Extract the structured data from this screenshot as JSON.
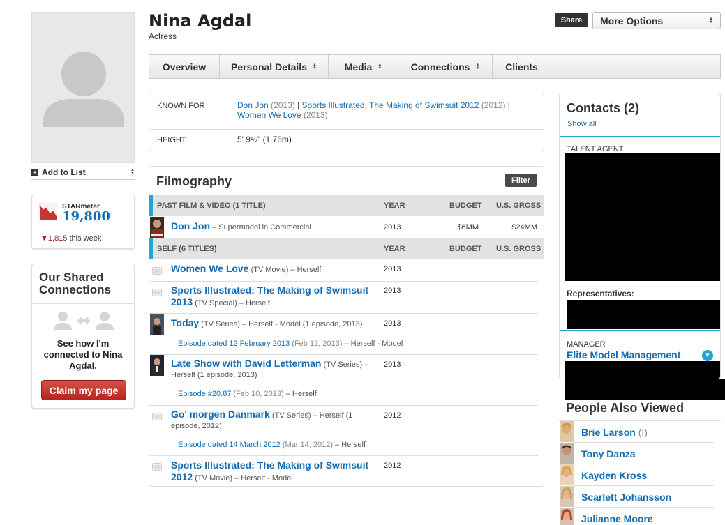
{
  "profile": {
    "name": "Nina Agdal",
    "job": "Actress",
    "add_to_list": "Add to List"
  },
  "starmeter": {
    "label": "STARmeter",
    "rank": "19,800",
    "change": "1,815",
    "change_suffix": " this week"
  },
  "shared": {
    "title": "Our Shared Connections",
    "message": "See how I'm connected to Nina Agdal.",
    "claim": "Claim my page"
  },
  "header": {
    "share": "Share",
    "more_options": "More Options"
  },
  "nav": {
    "tabs": [
      {
        "label": "Overview",
        "caret": false
      },
      {
        "label": "Personal Details",
        "caret": true
      },
      {
        "label": "Media",
        "caret": true
      },
      {
        "label": "Connections",
        "caret": true
      },
      {
        "label": "Clients",
        "caret": false
      }
    ]
  },
  "known_for": {
    "label": "KNOWN FOR",
    "titles": [
      {
        "title": "Don Jon",
        "year": "(2013)"
      },
      {
        "title": "Sports Illustrated: The Making of Swimsuit 2012",
        "year": "(2012)"
      },
      {
        "title": "Women We Love",
        "year": "(2013)"
      }
    ],
    "height_label": "HEIGHT",
    "height_value": "5' 9½\" (1.76m)"
  },
  "filmography": {
    "title": "Filmography",
    "filter": "Filter",
    "columns": {
      "year": "YEAR",
      "budget": "BUDGET",
      "gross": "U.S. GROSS"
    },
    "section1": "PAST FILM & VIDEO (1 TITLE)",
    "section2": "SELF (6 TITLES)",
    "film": {
      "title": "Don Jon",
      "role": " – Supermodel in Commercial",
      "year": "2013",
      "budget": "$6MM",
      "gross": "$24MM"
    },
    "self": [
      {
        "title": "Women We Love",
        "detail": " (TV Movie) – Herself",
        "year": "2013"
      },
      {
        "title": "Sports Illustrated: The Making of Swimsuit 2013",
        "detail": " (TV Special) – Herself",
        "year": "2013"
      },
      {
        "title": "Today",
        "detail": " (TV Series) – Herself - Model (1 episode, 2013)",
        "year": "2013",
        "episode": {
          "name": "Episode dated 12 February 2013",
          "date": " (Feb 12, 2013)",
          "role": " – Herself - Model"
        }
      },
      {
        "title": "Late Show with David Letterman",
        "detail": " (TV Series) – Herself (1 episode, 2013)",
        "year": "2013",
        "episode": {
          "name": "Episode #20.87",
          "date": " (Feb 10, 2013)",
          "role": " – Herself"
        }
      },
      {
        "title": "Go' morgen Danmark",
        "detail": " (TV Series) – Herself (1 episode, 2012)",
        "year": "2012",
        "episode": {
          "name": "Episode dated 14 March 2012",
          "date": " (Mar 14, 2012)",
          "role": " – Herself"
        }
      },
      {
        "title": "Sports Illustrated: The Making of Swimsuit 2012",
        "detail": " (TV Movie) – Herself - Model",
        "year": "2012"
      }
    ]
  },
  "contacts": {
    "title": "Contacts (2)",
    "show_all": "Show all",
    "talent_agent": "TALENT AGENT",
    "representatives": "Representatives:",
    "manager": "MANAGER",
    "manager_company": "Elite Model Management"
  },
  "people_also_viewed": {
    "title": "People Also Viewed",
    "people": [
      {
        "name": "Brie Larson",
        "extra": "(I)"
      },
      {
        "name": "Tony Danza",
        "extra": ""
      },
      {
        "name": "Kayden Kross",
        "extra": ""
      },
      {
        "name": "Scarlett Johansson",
        "extra": ""
      },
      {
        "name": "Julianne Moore",
        "extra": ""
      }
    ]
  },
  "colors": {
    "link": "#136cb2",
    "accent": "#2aa3d4",
    "claim": "#c0392b"
  }
}
